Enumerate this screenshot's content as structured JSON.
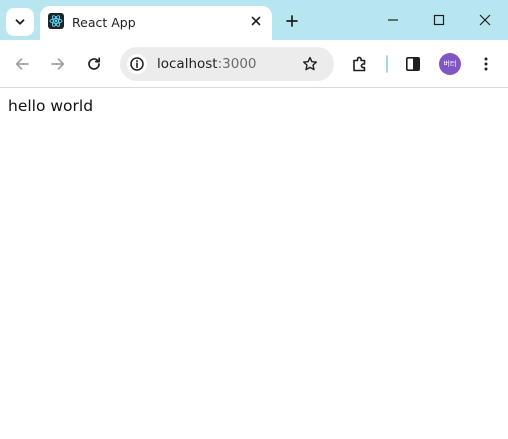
{
  "browser": {
    "tab": {
      "title": "React App",
      "favicon": "react-logo-icon"
    },
    "toolbar": {
      "url_host": "localhost",
      "url_port": ":3000"
    },
    "profile": {
      "initials": "버터",
      "color": "#7e57c2"
    },
    "colors": {
      "tabstrip": "#b8e6f0",
      "omnibox": "#ececec"
    }
  },
  "page": {
    "text": "hello world"
  }
}
